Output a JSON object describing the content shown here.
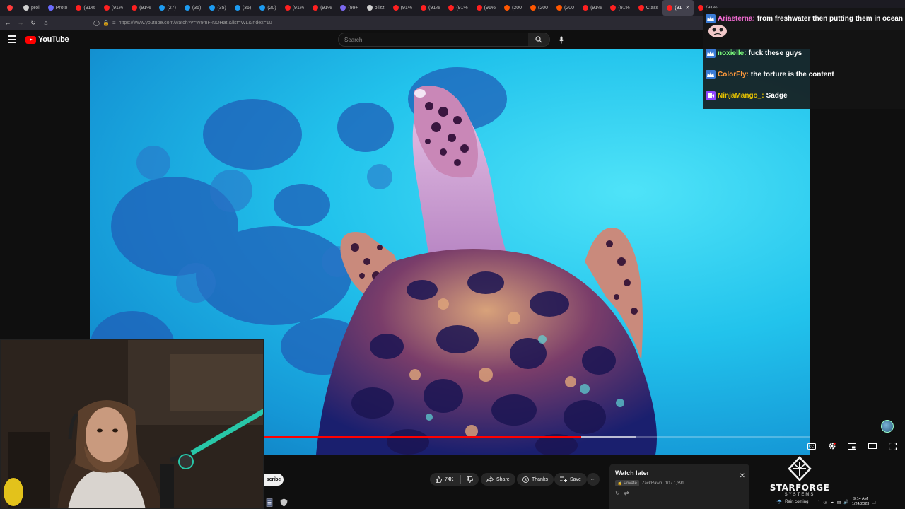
{
  "browser": {
    "tabs": [
      {
        "label": "",
        "color": "#ff3b3b"
      },
      {
        "label": "prol",
        "color": "#d0d0d0"
      },
      {
        "label": "Proto",
        "color": "#6b6bff"
      },
      {
        "label": "(91%",
        "color": "#ff2020"
      },
      {
        "label": "(91%",
        "color": "#ff2020"
      },
      {
        "label": "(91%",
        "color": "#ff2020"
      },
      {
        "label": "(27)",
        "color": "#1d9bf0"
      },
      {
        "label": "(35)",
        "color": "#1d9bf0"
      },
      {
        "label": "(35)",
        "color": "#1d9bf0"
      },
      {
        "label": "(36)",
        "color": "#1d9bf0"
      },
      {
        "label": "(20)",
        "color": "#1d9bf0"
      },
      {
        "label": "(91%",
        "color": "#ff2020"
      },
      {
        "label": "(91%",
        "color": "#ff2020"
      },
      {
        "label": "(99+",
        "color": "#7b68ee"
      },
      {
        "label": "blizz",
        "color": "#d0d0d0"
      },
      {
        "label": "(91%",
        "color": "#ff2020"
      },
      {
        "label": "(91%",
        "color": "#ff2020"
      },
      {
        "label": "(91%",
        "color": "#ff2020"
      },
      {
        "label": "(91%",
        "color": "#ff2020"
      },
      {
        "label": "(200",
        "color": "#ff5700"
      },
      {
        "label": "(200",
        "color": "#ff5700"
      },
      {
        "label": "(200",
        "color": "#ff5700"
      },
      {
        "label": "(91%",
        "color": "#ff2020"
      },
      {
        "label": "(91%",
        "color": "#ff2020"
      },
      {
        "label": "Class",
        "color": "#ff2020"
      },
      {
        "label": "(91",
        "color": "#ff2020",
        "active": true
      },
      {
        "label": "(91%",
        "color": "#ff2020"
      }
    ],
    "url": "https://www.youtube.com/watch?v=W9mF-NOHatI&list=WL&index=10"
  },
  "youtube": {
    "logo_text": "YouTube",
    "search_placeholder": "Search"
  },
  "video": {
    "progress_played": 0.683,
    "buffer_start": 0.683,
    "buffer_end": 0.758
  },
  "actions": {
    "subscribe_label": "scribe",
    "like_count": "74K",
    "share_label": "Share",
    "thanks_label": "Thanks",
    "save_label": "Save",
    "more_label": "···"
  },
  "watch_later": {
    "title": "Watch later",
    "privacy": "Private",
    "owner": "ZackRawrr",
    "position": "10 / 1,391"
  },
  "chat": [
    {
      "user": "Ariaeterna:",
      "text": "from freshwater then putting them in ocean",
      "user_color": "#f06ad0",
      "badge_color": "#3a7bd5",
      "badge": "crown-badge"
    },
    {
      "user": "noxielle:",
      "text": "fuck these guys",
      "user_color": "#7cff7c",
      "badge_color": "#3a7bd5",
      "badge": "crown-badge"
    },
    {
      "user": "ColorFly:",
      "text": "the torture is the content",
      "user_color": "#ff9a3c",
      "badge_color": "#3a7bd5",
      "badge": "crown-badge"
    },
    {
      "user": "NinjaMango_:",
      "text": "Sadge",
      "user_color": "#e6c200",
      "badge_color": "#9146ff",
      "badge": "video-badge"
    }
  ],
  "sponsor": {
    "name": "STARFORGE",
    "subtitle": "SYSTEMS"
  },
  "taskbar": {
    "weather": "Rain coming",
    "time": "9:14 AM",
    "date": "1/24/2023"
  }
}
